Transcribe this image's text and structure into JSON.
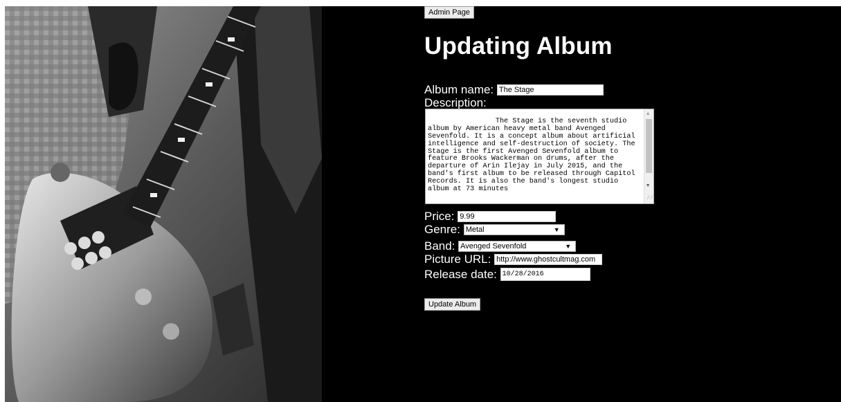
{
  "nav": {
    "admin_button": "Admin Page"
  },
  "page": {
    "title": "Updating Album"
  },
  "form": {
    "album_name_label": "Album name:",
    "album_name_value": "The Stage",
    "description_label": "Description:",
    "description_value": "            The Stage is the seventh studio album by American heavy metal band Avenged Sevenfold. It is a concept album about artificial intelligence and self-destruction of society. The Stage is the first Avenged Sevenfold album to feature Brooks Wackerman on drums, after the departure of Arin Ilejay in July 2015, and the band's first album to be released through Capitol Records. It is also the band's longest studio album at 73 minutes",
    "price_label": "Price:",
    "price_value": "9.99",
    "genre_label": "Genre:",
    "genre_value": "Metal",
    "band_label": "Band:",
    "band_value": "Avenged Sevenfold",
    "picture_url_label": "Picture URL:",
    "picture_url_value": "http://www.ghostcultmag.com",
    "release_date_label": "Release date:",
    "release_date_value": "10/28/2016",
    "submit_button": "Update Album"
  },
  "icons": {
    "dropdown": "chevron-down-icon",
    "scroll_up": "scroll-up-icon",
    "scroll_down": "scroll-down-icon",
    "resize": "resize-grip-icon"
  },
  "colors": {
    "background": "#000000",
    "text": "#ffffff",
    "input_bg": "#ffffff"
  }
}
